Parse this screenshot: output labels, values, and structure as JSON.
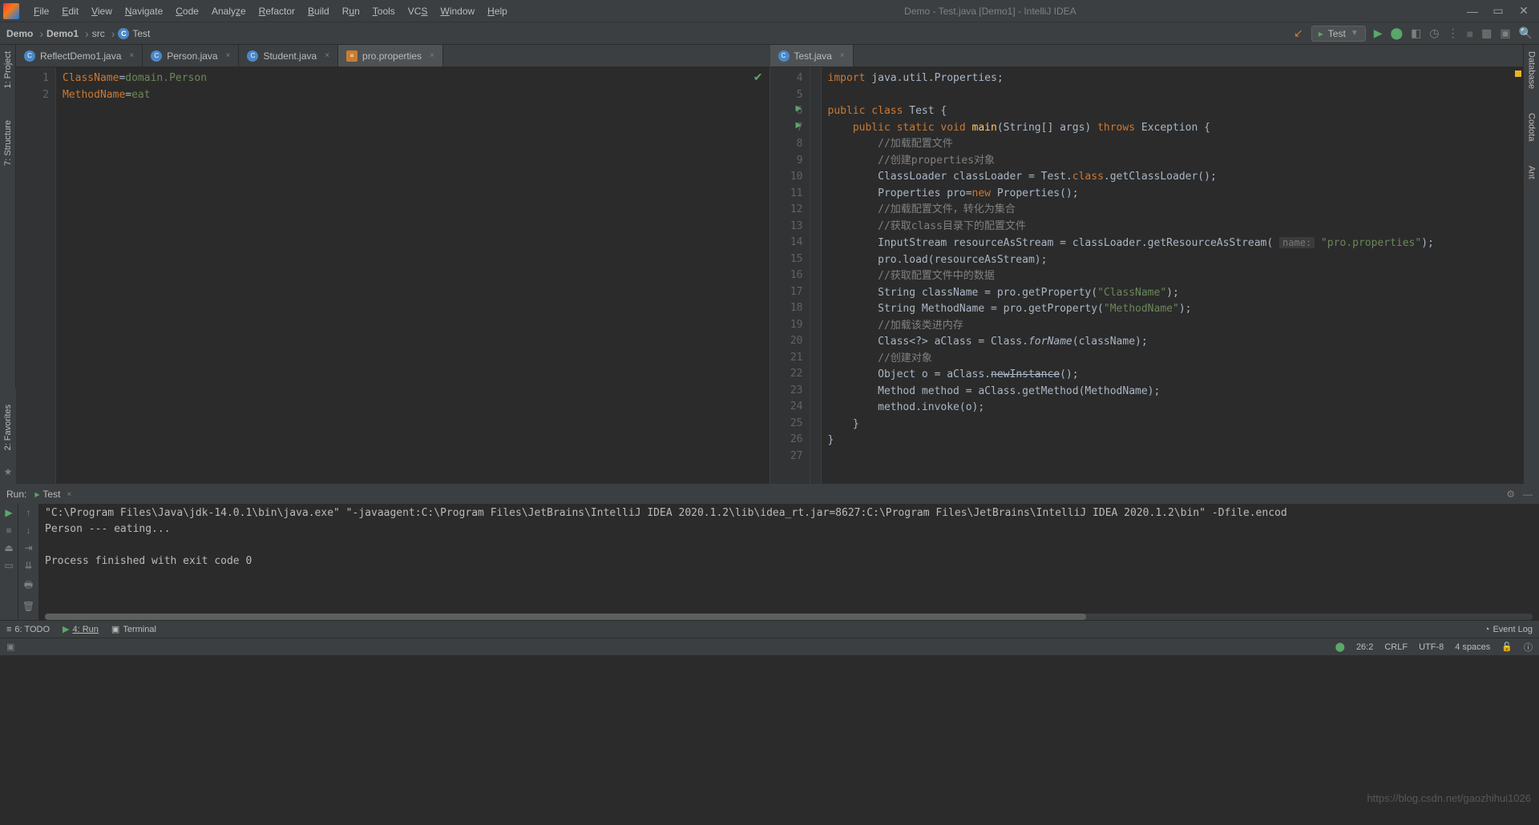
{
  "menu": [
    "File",
    "Edit",
    "View",
    "Navigate",
    "Code",
    "Analyze",
    "Refactor",
    "Build",
    "Run",
    "Tools",
    "VCS",
    "Window",
    "Help"
  ],
  "title": "Demo - Test.java [Demo1] - IntelliJ IDEA",
  "breadcrumbs": {
    "b1": "Demo",
    "b2": "Demo1",
    "b3": "src",
    "b4": "Test"
  },
  "run_config": "Test",
  "left_rail": {
    "project": "1: Project",
    "structure": "7: Structure"
  },
  "right_rail": {
    "database": "Database",
    "codota": "Codota",
    "ant": "Ant"
  },
  "tabs_left": [
    {
      "label": "ReflectDemo1.java",
      "type": "java"
    },
    {
      "label": "Person.java",
      "type": "java"
    },
    {
      "label": "Student.java",
      "type": "java"
    },
    {
      "label": "pro.properties",
      "type": "props",
      "active": true
    }
  ],
  "tabs_right": [
    {
      "label": "Test.java",
      "type": "java",
      "active": true
    }
  ],
  "props_code": {
    "l1k": "ClassName",
    "l1v": "domain.Person",
    "l2k": "MethodName",
    "l2v": "eat"
  },
  "java_lines": [
    "4",
    "5",
    "6",
    "7",
    "8",
    "9",
    "10",
    "11",
    "12",
    "13",
    "14",
    "15",
    "16",
    "17",
    "18",
    "19",
    "20",
    "21",
    "22",
    "23",
    "24",
    "25",
    "26",
    "27"
  ],
  "java_code": {
    "l4_1": "import ",
    "l4_2": "java.util.Properties;",
    "l6_1": "public class ",
    "l6_2": "Test ",
    "l6_3": "{",
    "l7_1": "public static void ",
    "l7_2": "main",
    "l7_3": "(String[] args) ",
    "l7_4": "throws ",
    "l7_5": "Exception {",
    "l8": "//加载配置文件",
    "l9": "//创建properties对象",
    "l10_1": "ClassLoader classLoader = Test.",
    "l10_2": "class",
    "l10_3": ".getClassLoader();",
    "l11_1": "Properties pro=",
    "l11_2": "new ",
    "l11_3": "Properties();",
    "l12": "//加载配置文件，转化为集合",
    "l13": "//获取class目录下的配置文件",
    "l14_1": "InputStream resourceAsStream = classLoader.getResourceAsStream( ",
    "l14_hint": "name:",
    "l14_2": " \"pro.properties\"",
    "l14_3": ");",
    "l15": "pro.load(resourceAsStream);",
    "l16": "//获取配置文件中的数据",
    "l17_1": "String className = pro.getProperty(",
    "l17_2": "\"ClassName\"",
    "l17_3": ");",
    "l18_1": "String MethodName = pro.getProperty(",
    "l18_2": "\"MethodName\"",
    "l18_3": ");",
    "l19": "//加载该类进内存",
    "l20_1": "Class<?> aClass = Class.",
    "l20_2": "forName",
    "l20_3": "(className);",
    "l21": "//创建对象",
    "l22_1": "Object o = aClass.",
    "l22_2": "newInstance",
    "l22_3": "();",
    "l23": "Method method = aClass.getMethod(MethodName);",
    "l24": "method.invoke(o);",
    "l25": "}",
    "l26": "}"
  },
  "run_panel": {
    "label": "Run:",
    "tab": "Test",
    "line1": "\"C:\\Program Files\\Java\\jdk-14.0.1\\bin\\java.exe\" \"-javaagent:C:\\Program Files\\JetBrains\\IntelliJ IDEA 2020.1.2\\lib\\idea_rt.jar=8627:C:\\Program Files\\JetBrains\\IntelliJ IDEA 2020.1.2\\bin\" -Dfile.encod",
    "line2": "Person  ---   eating...",
    "line3": "",
    "line4": "Process finished with exit code 0"
  },
  "bottom_tabs": {
    "todo": "6: TODO",
    "run": "4: Run",
    "terminal": "Terminal",
    "eventlog": "Event Log"
  },
  "status": {
    "pos": "26:2",
    "le": "CRLF",
    "enc": "UTF-8",
    "indent": "4 spaces"
  },
  "left_rail_bottom": {
    "favorites": "2: Favorites"
  },
  "watermark": "https://blog.csdn.net/gaozhihui1026"
}
